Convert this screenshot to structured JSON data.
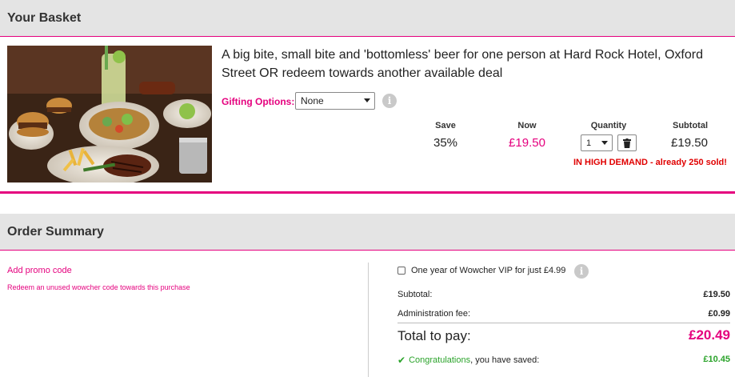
{
  "basket": {
    "title": "Your Basket",
    "deal_title": "A big bite, small bite and 'bottomless' beer for one person at Hard Rock Hotel, Oxford Street OR redeem towards another available deal",
    "gifting_label": "Gifting Options:",
    "gifting_selected": "None",
    "columns": {
      "save_label": "Save",
      "now_label": "Now",
      "quantity_label": "Quantity",
      "subtotal_label": "Subtotal"
    },
    "save_value": "35%",
    "now_value": "£19.50",
    "quantity_value": "1",
    "subtotal_value": "£19.50",
    "demand_text": "IN HIGH DEMAND - already 250 sold!"
  },
  "summary": {
    "title": "Order Summary",
    "promo_link": "Add promo code",
    "promo_sub": "Redeem an unused wowcher code towards this purchase",
    "vip_label": "One year of Wowcher VIP for just £4.99",
    "subtotal_label": "Subtotal:",
    "subtotal_value": "£19.50",
    "admin_label": "Administration fee:",
    "admin_value": "£0.99",
    "total_label": "Total to pay:",
    "total_value": "£20.49",
    "congrats_word": "Congratulations",
    "saved_suffix": ", you have saved:",
    "saved_value": "£10.45"
  },
  "icons": {
    "info": "info-icon",
    "trash": "trash-icon",
    "check": "check-icon",
    "caret": "chevron-down-icon"
  },
  "colors": {
    "accent": "#e5007e",
    "demand": "#e00000",
    "success": "#2aa32a",
    "header_bg": "#e4e4e4"
  }
}
